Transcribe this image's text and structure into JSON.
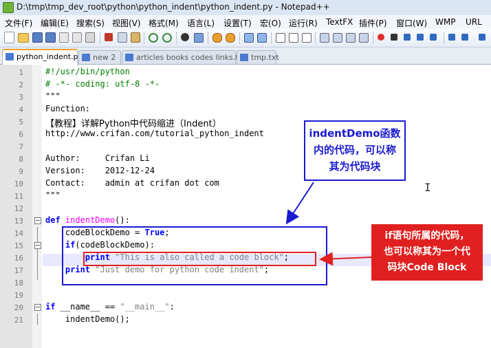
{
  "window": {
    "title": "D:\\tmp\\tmp_dev_root\\python\\python_indent\\python_indent.py - Notepad++"
  },
  "menu": [
    {
      "label": "文件(F)"
    },
    {
      "label": "编辑(E)"
    },
    {
      "label": "搜索(S)"
    },
    {
      "label": "视图(V)"
    },
    {
      "label": "格式(M)"
    },
    {
      "label": "语言(L)"
    },
    {
      "label": "设置(T)"
    },
    {
      "label": "宏(O)"
    },
    {
      "label": "运行(R)"
    },
    {
      "label": "TextFX"
    },
    {
      "label": "插件(P)"
    },
    {
      "label": "窗口(W)"
    },
    {
      "label": "WMP"
    },
    {
      "label": "URL"
    }
  ],
  "tabs": [
    {
      "label": "python_indent.py",
      "active": true
    },
    {
      "label": "new  2",
      "active": false
    },
    {
      "label": "articles books codes links.txt",
      "active": false
    },
    {
      "label": "tmp.txt",
      "active": false
    }
  ],
  "editor": {
    "lines": [
      {
        "num": "1",
        "text": "#!/usr/bin/python"
      },
      {
        "num": "2",
        "text": "# -*- coding: utf-8 -*-"
      },
      {
        "num": "3",
        "text": "\"\"\""
      },
      {
        "num": "4",
        "text": "Function:"
      },
      {
        "num": "5",
        "text": "【教程】详解Python中代码缩进（Indent）"
      },
      {
        "num": "6",
        "text": "http://www.crifan.com/tutorial_python_indent"
      },
      {
        "num": "7",
        "text": ""
      },
      {
        "num": "8",
        "text": "Author:     Crifan Li"
      },
      {
        "num": "9",
        "text": "Version:    2012-12-24"
      },
      {
        "num": "10",
        "text": "Contact:    admin at crifan dot com"
      },
      {
        "num": "11",
        "text": "\"\"\""
      },
      {
        "num": "12",
        "text": ""
      },
      {
        "num": "13",
        "text": "def indentDemo():"
      },
      {
        "num": "14",
        "text": "    codeBlockDemo = True;"
      },
      {
        "num": "15",
        "text": "    if(codeBlockDemo):"
      },
      {
        "num": "16",
        "text": "        print \"This is also called a code block\";"
      },
      {
        "num": "17",
        "text": "    print \"Just demo for python code indent\";"
      },
      {
        "num": "18",
        "text": ""
      },
      {
        "num": "19",
        "text": ""
      },
      {
        "num": "20",
        "text": "if __name__ == \"__main__\":"
      },
      {
        "num": "21",
        "text": "    indentDemo();"
      }
    ]
  },
  "annotations": {
    "blue_callout": [
      "indentDemo函数",
      "内的代码，可以称",
      "其为代码块"
    ],
    "red_callout": [
      "if语句所属的代码，",
      "也可以称其为一个代",
      "码块Code Block"
    ]
  },
  "colors": {
    "keyword": "#0000ff",
    "function_name": "#ff00ff",
    "string": "#808080",
    "comment": "#007f00",
    "annotation_blue": "#1a1ad0",
    "annotation_red": "#e02020"
  }
}
